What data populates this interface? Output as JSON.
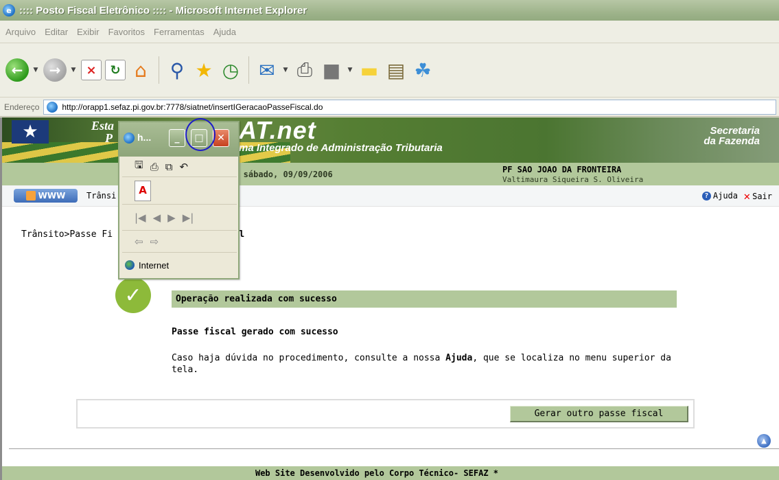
{
  "window": {
    "title": ":::: Posto Fiscal Eletrônico :::: - Microsoft Internet Explorer"
  },
  "menu": [
    "Arquivo",
    "Editar",
    "Exibir",
    "Favoritos",
    "Ferramentas",
    "Ajuda"
  ],
  "toolbar": {
    "icons": [
      "back-icon",
      "forward-icon",
      "stop-icon",
      "refresh-icon",
      "home-icon",
      "search-icon",
      "favorites-icon",
      "history-icon",
      "mail-icon",
      "print-icon",
      "edit-icon",
      "discuss-icon",
      "notes-icon",
      "research-icon",
      "messenger-icon"
    ]
  },
  "address": {
    "label": "Endereço",
    "url": "http://orapp1.sefaz.pi.gov.br:7778/siatnet/insertIGeracaoPasseFiscal.do"
  },
  "banner": {
    "state_line1": "Esta",
    "state_line2": "P",
    "brand": "AT.net",
    "subtitle": "ma Integrado de Administração Tributaria",
    "secretaria": "Secretaria",
    "fazenda": "da Fazenda"
  },
  "infobar": {
    "date": "a! sábado, 09/09/2006",
    "post": "PF SAO JOAO DA FRONTEIRA",
    "user": "Valtimaura Siqueira S. Oliveira"
  },
  "nav": {
    "www": "WWW",
    "breadcrumb": "Trânsi                    esso",
    "help": "Ajuda",
    "exit": "Sair"
  },
  "content": {
    "path_prefix": "Trânsito>Passe Fi",
    "path_suffix": "iscal",
    "op_status": "Operação realizada com sucesso",
    "msg_title": "Passe fiscal gerado com sucesso",
    "msg_text_pre": "Caso haja dúvida no procedimento, consulte a nossa ",
    "msg_text_link": "Ajuda",
    "msg_text_post": ", que se localiza no menu superior da tela.",
    "button": "Gerar outro passe fiscal"
  },
  "footer": "Web Site Desenvolvido pelo Corpo Técnico- SEFAZ *",
  "popup": {
    "title": "h...",
    "status": "Internet"
  },
  "colors": {
    "accent_green": "#b2c89b",
    "success_green": "#8dba3a",
    "highlight_circle": "#1e1ec8"
  }
}
